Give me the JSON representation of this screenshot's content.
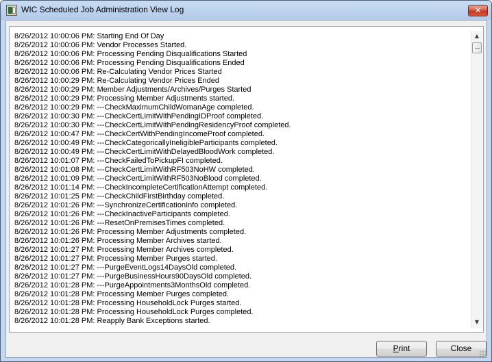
{
  "window": {
    "title": "WIC Scheduled Job Administration View Log",
    "close_glyph": "✕",
    "app_icon": "app-icon",
    "close_color": "#c4381f"
  },
  "log": {
    "lines": [
      "8/26/2012 10:00:06 PM: Starting End Of Day",
      "8/26/2012 10:00:06 PM: Vendor Processes Started.",
      "8/26/2012 10:00:06 PM: Processing Pending Disqualifications Started",
      "8/26/2012 10:00:06 PM: Processing Pending Disqualifications Ended",
      "8/26/2012 10:00:06 PM: Re-Calculating Vendor Prices Started",
      "8/26/2012 10:00:29 PM: Re-Calculating Vendor Prices Ended",
      "8/26/2012 10:00:29 PM: Member Adjustments/Archives/Purges Started",
      "8/26/2012 10:00:29 PM: Processing Member Adjustments started.",
      "8/26/2012 10:00:29 PM: ---CheckMaximumChildWomanAge completed.",
      "8/26/2012 10:00:30 PM: ---CheckCertLimitWithPendingIDProof completed.",
      "8/26/2012 10:00:30 PM: ---CheckCertLimitWithPendingResidencyProof completed.",
      "8/26/2012 10:00:47 PM: ---CheckCertWithPendingIncomeProof completed.",
      "8/26/2012 10:00:49 PM: ---CheckCategoricallyIneligibleParticipants completed.",
      "8/26/2012 10:00:49 PM: ---CheckCertLimitWithDelayedBloodWork completed.",
      "8/26/2012 10:01:07 PM: ---CheckFailedToPickupFI completed.",
      "8/26/2012 10:01:08 PM: ---CheckCertLimitWithRF503NoHW completed.",
      "8/26/2012 10:01:09 PM: ---CheckCertLimitWithRF503NoBlood completed.",
      "8/26/2012 10:01:14 PM: ---CheckIncompleteCertificationAttempt completed.",
      "8/26/2012 10:01:25 PM: ---CheckChildFirstBirthday completed.",
      "8/26/2012 10:01:26 PM: ---SynchronizeCertificationInfo completed.",
      "8/26/2012 10:01:26 PM: ---CheckInactiveParticipants completed.",
      "8/26/2012 10:01:26 PM: ---ResetOnPremisesTimes completed.",
      "8/26/2012 10:01:26 PM: Processing Member Adjustments completed.",
      "8/26/2012 10:01:26 PM: Processing Member Archives started.",
      "8/26/2012 10:01:27 PM: Processing Member Archives completed.",
      "8/26/2012 10:01:27 PM: Processing Member Purges started.",
      "8/26/2012 10:01:27 PM: ---PurgeEventLogs14DaysOld completed.",
      "8/26/2012 10:01:27 PM: ---PurgeBusinessHours90DaysOld completed.",
      "8/26/2012 10:01:28 PM: ---PurgeAppointments3MonthsOld completed.",
      "8/26/2012 10:01:28 PM: Processing Member Purges completed.",
      "8/26/2012 10:01:28 PM: Processing HouseholdLock Purges started.",
      "8/26/2012 10:01:28 PM: Processing HouseholdLock Purges completed.",
      "8/26/2012 10:01:28 PM: Reapply Bank Exceptions started."
    ]
  },
  "scrollbar": {
    "up_glyph": "▲",
    "down_glyph": "▼"
  },
  "buttons": {
    "print_mnemonic": "P",
    "print_rest": "rint",
    "close_label": "Close"
  }
}
